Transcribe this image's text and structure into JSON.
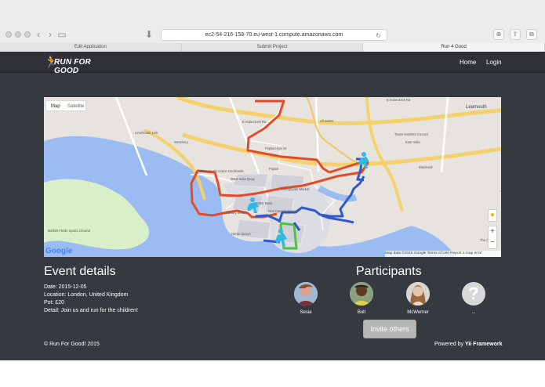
{
  "browser": {
    "url": "ec2-54-216-158-70.eu-west-1.compute.amazonaws.com",
    "tabs": [
      {
        "label": "Edit Application"
      },
      {
        "label": "Submit Project"
      },
      {
        "label": "Run 4 Good"
      }
    ]
  },
  "nav": {
    "brand": "RUN FOR GOOD",
    "items": [
      {
        "label": "Home"
      },
      {
        "label": "Login"
      }
    ]
  },
  "map": {
    "type_options": [
      {
        "label": "Map"
      },
      {
        "label": "Satellite"
      }
    ],
    "attribution": "Map data ©2015 Google   Terms of Use   Report a map error",
    "brand": "Google",
    "labels": [
      "E India Dock Rd",
      "E India Dock Rd",
      "All Saints",
      "Leamouth",
      "Limehouse Link",
      "Westferry",
      "Poplar",
      "Poplar High St",
      "East India",
      "Tower Hamlets Council",
      "Blackwall",
      "Museum of London Docklands",
      "West India Quay",
      "Billingsgate Market",
      "HSBC Bank",
      "One Canada Square",
      "Canary Wharf",
      "Heron Quays",
      "Mellish Fields Sports Ground",
      "The O2"
    ]
  },
  "event": {
    "title": "Event details",
    "date": "Date: 2015-12-05",
    "location": "Location: London, United Kingdom",
    "pot": "Pot: £20",
    "detail": "Detail: Join us and run for the children!"
  },
  "participants": {
    "title": "Participants",
    "people": [
      {
        "name": "Sesia"
      },
      {
        "name": "Bolt"
      },
      {
        "name": "McWerner"
      },
      {
        "name": "..."
      }
    ],
    "invite_label": "Invite others"
  },
  "footer": {
    "copyright": "© Run For Good! 2015",
    "powered_prefix": "Powered by",
    "powered_link": "Yii Framework"
  },
  "colors": {
    "page": "#343a40",
    "route_red": "#e04b2b",
    "route_blue": "#3158c9",
    "route_green": "#4ac447",
    "runner": "#2fb9e8",
    "brand": "#3cc7f1"
  }
}
